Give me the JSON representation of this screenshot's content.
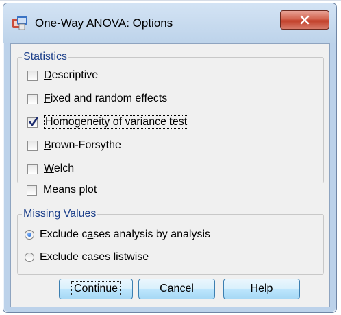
{
  "window": {
    "title": "One-Way ANOVA: Options"
  },
  "statistics": {
    "title": "Statistics",
    "items": [
      {
        "pre": "",
        "key": "D",
        "post": "escriptive",
        "checked": false
      },
      {
        "pre": "",
        "key": "F",
        "post": "ixed and random effects",
        "checked": false
      },
      {
        "pre": "",
        "key": "H",
        "post": "omogeneity of variance test",
        "checked": true
      },
      {
        "pre": "",
        "key": "B",
        "post": "rown-Forsythe",
        "checked": false
      },
      {
        "pre": "",
        "key": "W",
        "post": "elch",
        "checked": false
      }
    ]
  },
  "means_plot": {
    "pre": "",
    "key": "M",
    "post": "eans plot",
    "checked": false
  },
  "missing": {
    "title": "Missing Values",
    "items": [
      {
        "pre": "Exclude c",
        "key": "a",
        "post": "ses analysis by analysis",
        "selected": true
      },
      {
        "pre": "Exc",
        "key": "l",
        "post": "ude cases listwise",
        "selected": false
      }
    ]
  },
  "buttons": {
    "continue": "Continue",
    "cancel": "Cancel",
    "help": "Help"
  },
  "colors": {
    "group_title": "#1c3f8a",
    "titlebar": "#bdd3ea",
    "close": "#c2402a"
  }
}
